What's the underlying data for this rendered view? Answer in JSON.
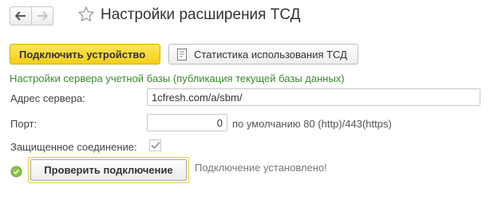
{
  "header": {
    "title": "Настройки расширения ТСД",
    "back_icon": "arrow-left-icon",
    "forward_icon": "arrow-right-icon",
    "favorite_icon": "star-icon"
  },
  "toolbar": {
    "connect_label": "Подключить устройство",
    "stats_label": "Статистика использования ТСД",
    "stats_icon": "report-icon"
  },
  "form": {
    "section_title": "Настройки сервера учетной базы (публикация текущей базы данных)",
    "server_label": "Адрес сервера:",
    "server_value": "1cfresh.com/a/sbm/",
    "port_label": "Порт:",
    "port_value": "0",
    "port_hint": "по умолчанию 80 (http)/443(https)",
    "secure_label": "Защищенное соединение:",
    "secure_checked": true
  },
  "check": {
    "button_label": "Проверить подключение",
    "status_text": "Подключение установлено!",
    "status_icon": "check-circle-icon",
    "status_color": "#8bc34a"
  },
  "colors": {
    "accent_yellow": "#f6d41a",
    "section_green": "#3a8a2d"
  }
}
